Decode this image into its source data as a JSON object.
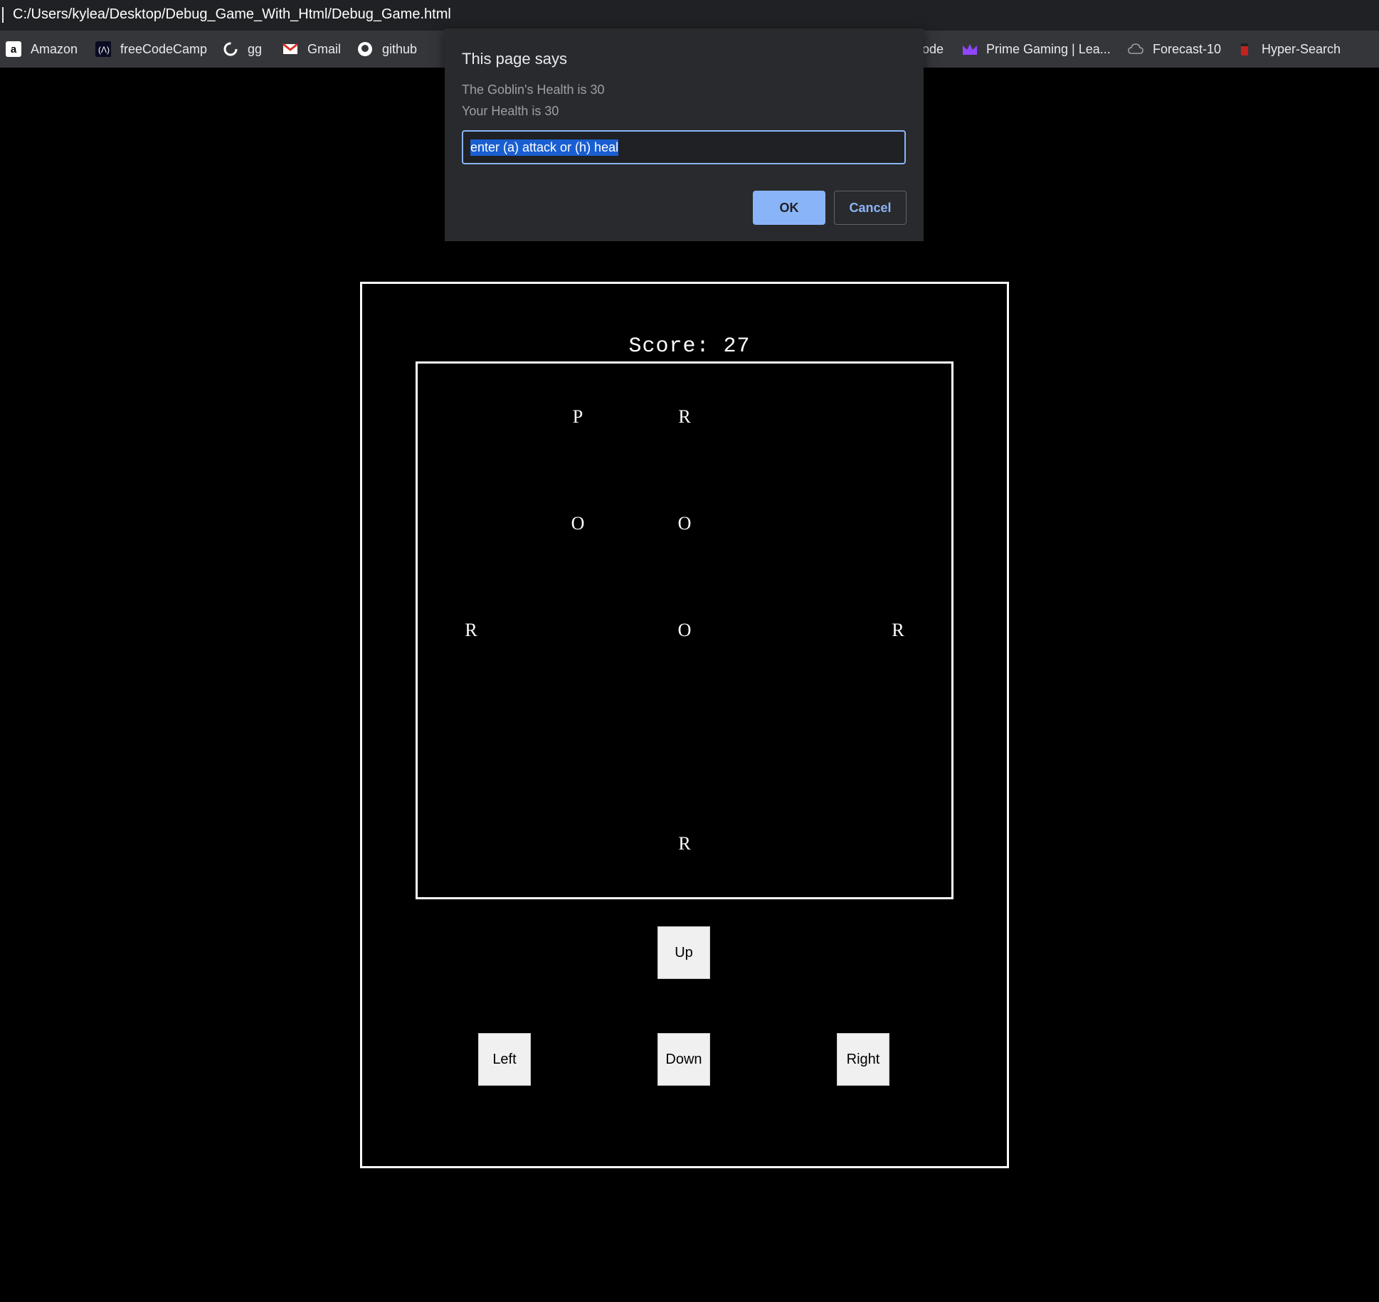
{
  "browser": {
    "url": "C:/Users/kylea/Desktop/Debug_Game_With_Html/Debug_Game.html",
    "bookmarks": [
      {
        "label": "Amazon",
        "icon": "amazon-icon"
      },
      {
        "label": "freeCodeCamp",
        "icon": "freecodecamp-icon"
      },
      {
        "label": "gg",
        "icon": "gg-icon"
      },
      {
        "label": "Gmail",
        "icon": "gmail-icon"
      },
      {
        "label": "github",
        "icon": "github-icon"
      },
      {
        "label": "ode",
        "icon": ""
      },
      {
        "label": "Prime Gaming | Lea...",
        "icon": "prime-gaming-icon"
      },
      {
        "label": "Forecast-10",
        "icon": "cloud-icon"
      },
      {
        "label": "Hyper-Search",
        "icon": "hyper-search-icon"
      }
    ]
  },
  "dialog": {
    "title": "This page says",
    "line1": "The Goblin's Health is 30",
    "line2": "Your Health is 30",
    "input_value": "enter (a) attack or (h) heal",
    "ok_label": "OK",
    "cancel_label": "Cancel"
  },
  "game": {
    "score_text": "Score: 27",
    "grid_size": 5,
    "cells": [
      {
        "symbol": "P",
        "row": 0,
        "col": 1
      },
      {
        "symbol": "R",
        "row": 0,
        "col": 2
      },
      {
        "symbol": "O",
        "row": 1,
        "col": 1
      },
      {
        "symbol": "O",
        "row": 1,
        "col": 2
      },
      {
        "symbol": "R",
        "row": 2,
        "col": 0
      },
      {
        "symbol": "O",
        "row": 2,
        "col": 2
      },
      {
        "symbol": "R",
        "row": 2,
        "col": 4
      },
      {
        "symbol": "R",
        "row": 4,
        "col": 2
      }
    ],
    "controls": {
      "up": "Up",
      "left": "Left",
      "down": "Down",
      "right": "Right"
    }
  }
}
